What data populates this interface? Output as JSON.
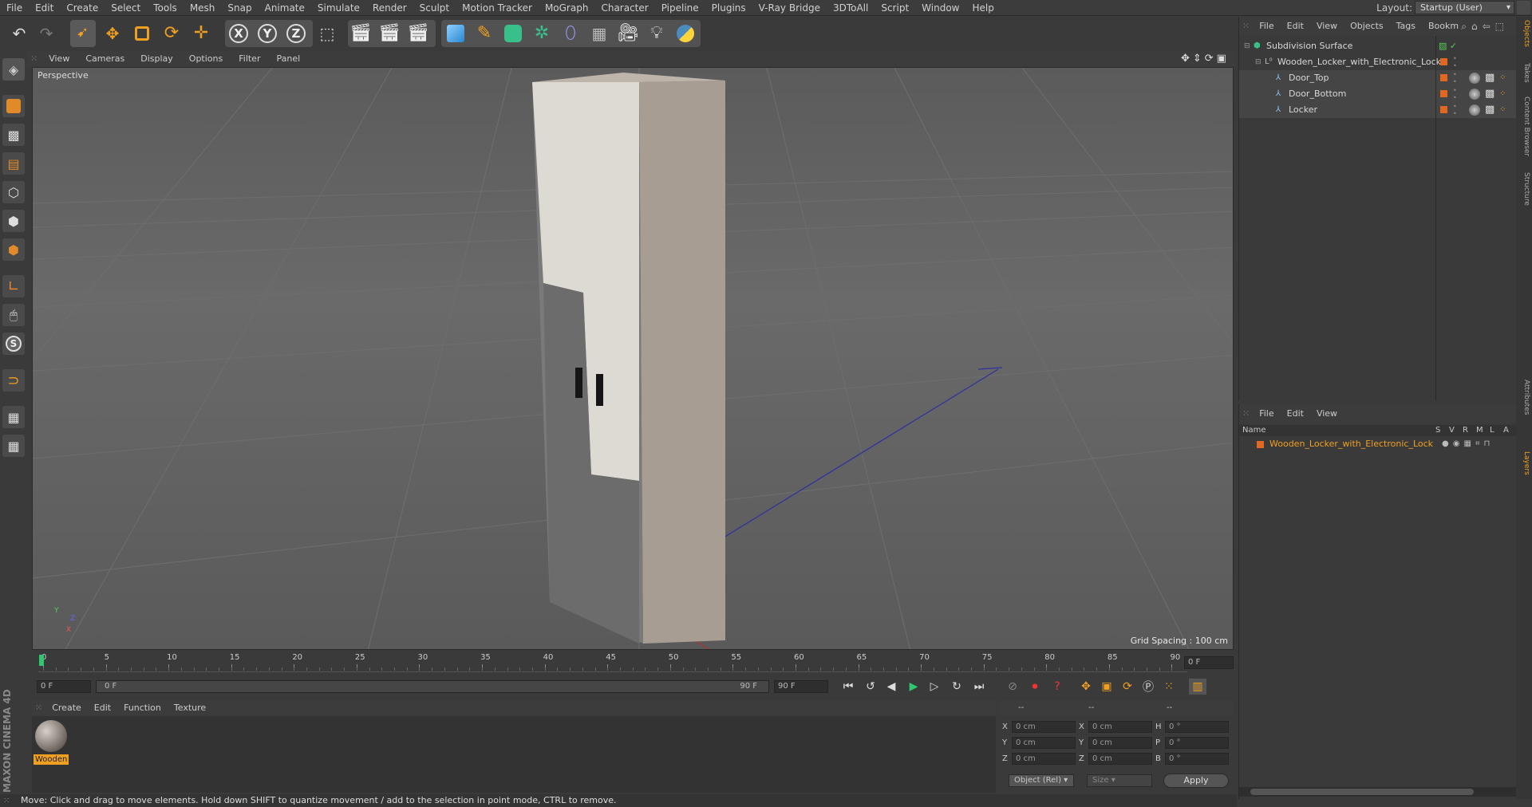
{
  "menubar": {
    "items": [
      "File",
      "Edit",
      "Create",
      "Select",
      "Tools",
      "Mesh",
      "Snap",
      "Animate",
      "Simulate",
      "Render",
      "Sculpt",
      "Motion Tracker",
      "MoGraph",
      "Character",
      "Pipeline",
      "Plugins",
      "V-Ray Bridge",
      "3DToAll",
      "Script",
      "Window",
      "Help"
    ],
    "layout_label": "Layout:",
    "layout_value": "Startup (User)"
  },
  "toolbar": {
    "axis_x": "X",
    "axis_y": "Y",
    "axis_z": "Z"
  },
  "viewport": {
    "menu": [
      "View",
      "Cameras",
      "Display",
      "Options",
      "Filter",
      "Panel"
    ],
    "label": "Perspective",
    "grid_spacing": "Grid Spacing : 100 cm",
    "axis_labels": {
      "y": "Y",
      "z": "Z",
      "x": "X"
    }
  },
  "timeline": {
    "ticks": [
      "0",
      "5",
      "10",
      "15",
      "20",
      "25",
      "30",
      "35",
      "40",
      "45",
      "50",
      "55",
      "60",
      "65",
      "70",
      "75",
      "80",
      "85",
      "90"
    ],
    "current_frame": "0 F",
    "start_field": "0 F",
    "range_start": "0 F",
    "range_end": "90 F",
    "end_field": "90 F"
  },
  "material_panel": {
    "menu": [
      "Create",
      "Edit",
      "Function",
      "Texture"
    ],
    "materials": [
      {
        "name": "Wooden",
        "selected": true
      }
    ]
  },
  "coords": {
    "header": [
      "--",
      "--",
      "--"
    ],
    "rows": [
      {
        "a": "X",
        "a_val": "0 cm",
        "b": "X",
        "b_val": "0 cm",
        "c": "H",
        "c_val": "0 °"
      },
      {
        "a": "Y",
        "a_val": "0 cm",
        "b": "Y",
        "b_val": "0 cm",
        "c": "P",
        "c_val": "0 °"
      },
      {
        "a": "Z",
        "a_val": "0 cm",
        "b": "Z",
        "b_val": "0 cm",
        "c": "B",
        "c_val": "0 °"
      }
    ],
    "mode_select": "Object (Rel)",
    "size_select": "Size",
    "apply": "Apply"
  },
  "object_manager": {
    "menu": [
      "File",
      "Edit",
      "View",
      "Objects",
      "Tags",
      "Bookm"
    ],
    "objects": [
      {
        "name": "Subdivision Surface",
        "depth": 0
      },
      {
        "name": "Wooden_Locker_with_Electronic_Lock",
        "depth": 1
      },
      {
        "name": "Door_Top",
        "depth": 2
      },
      {
        "name": "Door_Bottom",
        "depth": 2
      },
      {
        "name": "Locker",
        "depth": 2
      }
    ]
  },
  "layer_manager": {
    "menu": [
      "File",
      "Edit",
      "View"
    ],
    "columns": [
      "Name",
      "S",
      "V",
      "R",
      "M",
      "L",
      "A"
    ],
    "layers": [
      {
        "name": "Wooden_Locker_with_Electronic_Lock",
        "color": "#e06820"
      }
    ]
  },
  "right_tabs": [
    "Objects",
    "Takes",
    "Content Browser",
    "Structure",
    "Attributes",
    "Layers"
  ],
  "status": "Move: Click and drag to move elements. Hold down SHIFT to quantize movement / add to the selection in point mode, CTRL to remove.",
  "logo_text": "MAXON CINEMA 4D",
  "colors": {
    "accent_orange": "#f0a020",
    "layer_orange": "#e06820",
    "ui_bg": "#3a3a3a"
  }
}
